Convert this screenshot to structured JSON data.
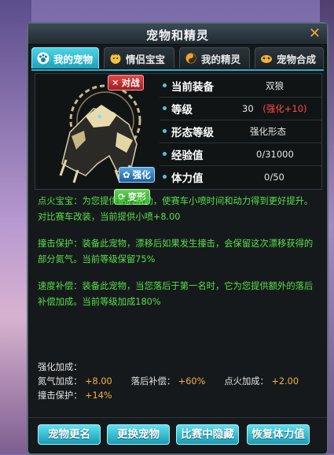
{
  "window": {
    "title": "宠物和精灵",
    "close_label": "✕"
  },
  "tabs": [
    {
      "label": "我的宠物",
      "icon": "paw-icon",
      "active": true
    },
    {
      "label": "情侣宝宝",
      "icon": "baby-face-icon",
      "active": false
    },
    {
      "label": "我的精灵",
      "icon": "spirit-icon",
      "active": false
    },
    {
      "label": "宠物合成",
      "icon": "merge-icon",
      "active": false
    }
  ],
  "pet": {
    "tag_fight": "对战",
    "tag_enhance": "强化",
    "tag_transform": "变形",
    "stats": [
      {
        "key": "当前装备",
        "value": "双狼"
      },
      {
        "key": "等级",
        "value": "30",
        "extra": "(强化+10)"
      },
      {
        "key": "形态等级",
        "value": "强化形态"
      },
      {
        "key": "经验值",
        "value": "0/31000"
      },
      {
        "key": "体力值",
        "value": "0/50"
      }
    ]
  },
  "skills": [
    "点火宝宝：为您提供贴心帮助，使赛车小喷时间和动力得到更好提升。对比赛车改装，当前提供小喷+8.00",
    "撞击保护：装备此宠物，漂移后如果发生撞击，会保留这次漂移获得的部分氮气。当前等级保留75%",
    "速度补偿：装备此宠物，当您落后于第一名时，它为您提供额外的落后补偿加成。当前等级加成180%"
  ],
  "enhance": {
    "title": "强化加成：",
    "items": [
      {
        "label": "氮气加成：",
        "value": "+8.00"
      },
      {
        "label": "落后补偿：",
        "value": "+60%"
      },
      {
        "label": "点火加成：",
        "value": "+2.00"
      },
      {
        "label": "撞击保护：",
        "value": "+14%"
      }
    ]
  },
  "buttons": [
    "宠物更名",
    "更换宠物",
    "比赛中隐藏",
    "恢复体力值"
  ],
  "colors": {
    "accent": "#27b0c7",
    "skill_text": "#57e04b",
    "highlight_red": "#ff4a4a",
    "bonus_value": "#f0b43f"
  }
}
